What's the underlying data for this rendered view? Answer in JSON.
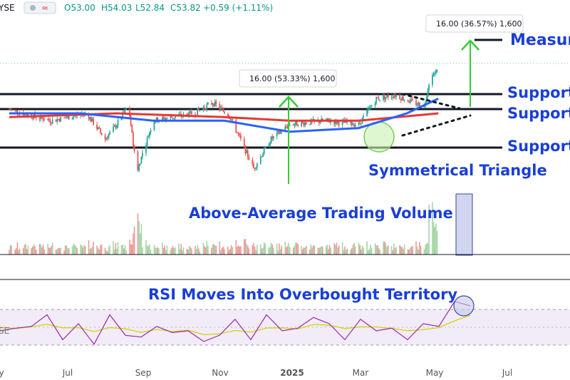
{
  "header": {
    "symbol_fragment": "YSE",
    "open": "O53.00",
    "high": "H54.03",
    "low": "L52.84",
    "close": "C53.82",
    "change": "+0.59 (+1.11%)"
  },
  "annotations": {
    "measure": "Measure",
    "support1": "Support",
    "support2": "Support",
    "support3": "Support",
    "triangle": "Symmetrical Triangle",
    "volume": "Above-Average Trading Volume",
    "rsi": "RSI Moves Into Overbought Territory",
    "measure_label_1": "16.00 (53.33%) 1,600",
    "measure_label_2": "16.00 (36.57%) 1,600"
  },
  "colors": {
    "up": "#26a69a",
    "down": "#ef5350",
    "ma_fast": "#2962ff",
    "ma_slow": "#e53935",
    "annotation": "#1a3fd6",
    "arrow": "#33cc33",
    "rsi_line": "#9c27b0",
    "rsi_signal": "#d4d400",
    "rsi_band": "#ede7f6",
    "volume_highlight": "#c5cae9"
  },
  "chart_data": {
    "type": "candlestick",
    "x_ticks": [
      "y",
      "Jul",
      "Sep",
      "Nov",
      "2025",
      "Mar",
      "May",
      "Jul"
    ],
    "price_points": [
      {
        "date": "2024-05-15",
        "price": 43
      },
      {
        "date": "2024-06-20",
        "price": 40
      },
      {
        "date": "2024-07-20",
        "price": 42
      },
      {
        "date": "2024-08-05",
        "price": 35
      },
      {
        "date": "2024-08-15",
        "price": 39
      },
      {
        "date": "2024-08-25",
        "price": 44
      },
      {
        "date": "2024-09-01",
        "price": 26
      },
      {
        "date": "2024-09-15",
        "price": 40
      },
      {
        "date": "2024-10-20",
        "price": 42
      },
      {
        "date": "2024-11-05",
        "price": 45
      },
      {
        "date": "2024-11-20",
        "price": 41
      },
      {
        "date": "2024-12-10",
        "price": 27
      },
      {
        "date": "2024-12-25",
        "price": 35
      },
      {
        "date": "2025-01-10",
        "price": 39
      },
      {
        "date": "2025-02-10",
        "price": 40
      },
      {
        "date": "2025-03-10",
        "price": 39
      },
      {
        "date": "2025-03-25",
        "price": 46
      },
      {
        "date": "2025-04-10",
        "price": 47
      },
      {
        "date": "2025-04-25",
        "price": 45
      },
      {
        "date": "2025-05-05",
        "price": 44
      },
      {
        "date": "2025-05-10",
        "price": 52
      },
      {
        "date": "2025-05-17",
        "price": 53.8
      }
    ],
    "moving_average_fast": [
      {
        "date": "2024-05-15",
        "price": 42
      },
      {
        "date": "2024-07-15",
        "price": 42
      },
      {
        "date": "2024-09-15",
        "price": 40
      },
      {
        "date": "2024-11-15",
        "price": 40
      },
      {
        "date": "2025-01-10",
        "price": 37
      },
      {
        "date": "2025-03-10",
        "price": 38
      },
      {
        "date": "2025-04-20",
        "price": 42
      },
      {
        "date": "2025-05-17",
        "price": 46
      }
    ],
    "moving_average_slow": [
      {
        "date": "2024-05-15",
        "price": 41
      },
      {
        "date": "2024-08-15",
        "price": 42
      },
      {
        "date": "2024-11-15",
        "price": 41
      },
      {
        "date": "2025-01-10",
        "price": 40
      },
      {
        "date": "2025-03-10",
        "price": 40
      },
      {
        "date": "2025-05-17",
        "price": 42
      }
    ],
    "support_levels": [
      47,
      44.5,
      38
    ],
    "measured_moves": [
      {
        "from_price": 30,
        "to_price": 46,
        "from_date": "2024-12-25",
        "label": "16.00 (53.33%) 1,600"
      },
      {
        "from_price": 44,
        "to_price": 60,
        "from_date": "2025-05-20",
        "label": "16.00 (36.57%) 1,600"
      }
    ],
    "triangle": {
      "upper": [
        {
          "date": "2025-03-25",
          "price": 47
        },
        {
          "date": "2025-05-15",
          "price": 43
        }
      ],
      "lower": [
        {
          "date": "2025-03-25",
          "price": 38
        },
        {
          "date": "2025-05-15",
          "price": 43
        }
      ]
    },
    "rsi_band": [
      30,
      70
    ],
    "rsi_levels": [
      50,
      45,
      55,
      60,
      40,
      50,
      35,
      60,
      45,
      35,
      55,
      40,
      50,
      30,
      45,
      55,
      40,
      60,
      50,
      45,
      65,
      50,
      40,
      55,
      50,
      45,
      40,
      50,
      55,
      75,
      78
    ]
  }
}
